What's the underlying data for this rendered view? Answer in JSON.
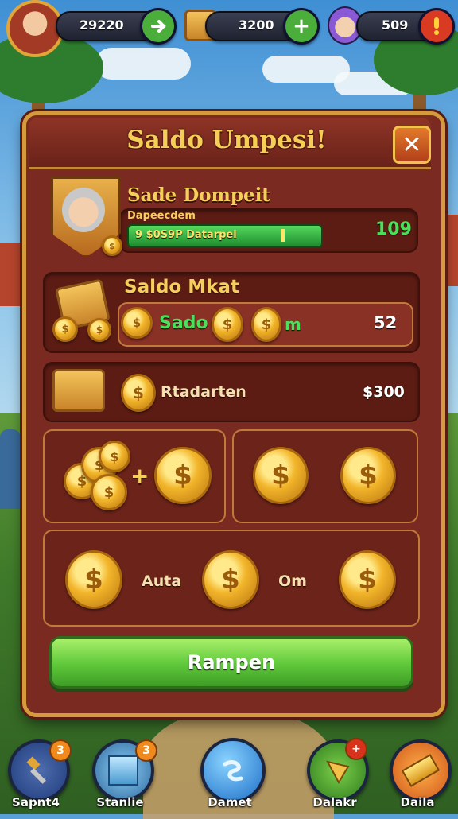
{
  "hud": {
    "player_value": "29220",
    "gold_value": "3200",
    "gems_value": "509"
  },
  "dialog": {
    "title": "Saldo Umpesi!",
    "close_label": "✕",
    "deposit": {
      "title": "Sade Dompeit",
      "subtitle": "Dapeecdem",
      "bar_text": "9 $0S9P Datarpel",
      "amount": "109"
    },
    "saldo_mikat": {
      "title": "Saldo Mkat",
      "label": "Sado",
      "suffix": "m",
      "amount": "52"
    },
    "rewards_row": {
      "label": "Rtadarten",
      "amount": "$300"
    },
    "plus_sign": "+",
    "bottom_row": {
      "label_1": "Auta",
      "label_2": "Om"
    },
    "cta_label": "Rampen"
  },
  "nav": [
    {
      "label": "Sapnt4",
      "badge": "3",
      "icon": "hammer-icon"
    },
    {
      "label": "Stanlie",
      "badge": "3",
      "icon": "gem-cube-icon"
    },
    {
      "label": "Damet",
      "badge": "",
      "icon": "swirl-icon"
    },
    {
      "label": "Dalakr",
      "badge": "+",
      "icon": "flag-icon"
    },
    {
      "label": "Daila",
      "badge": "",
      "icon": "gold-bar-icon"
    }
  ],
  "colors": {
    "dialog_bg": "#7a2a20",
    "dialog_border": "#d59a3c",
    "title_gold": "#f6cd55",
    "cta_green": "#5ec83a",
    "amount_green": "#4be05a"
  }
}
